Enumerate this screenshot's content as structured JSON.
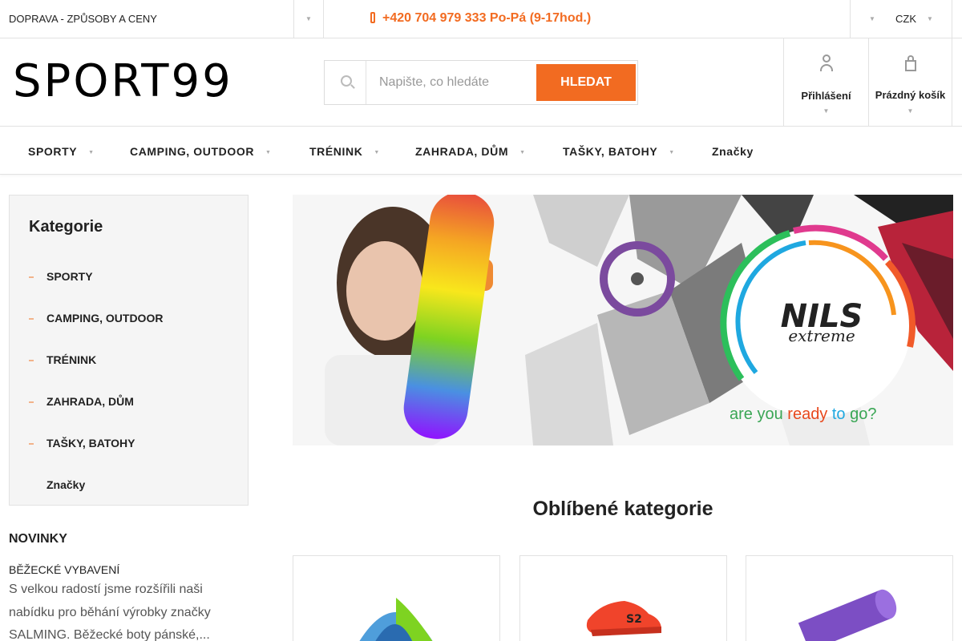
{
  "topbar": {
    "shipping_link": "DOPRAVA - ZPŮSOBY A CENY",
    "phone": "+420 704 979 333 Po-Pá (9-17hod.)",
    "currency": "CZK"
  },
  "header": {
    "logo_text": "SPORT99",
    "search": {
      "placeholder": "Napište, co hledáte",
      "button_label": "HLEDAT"
    },
    "login_label": "Přihlášení",
    "cart_label": "Prázdný košík"
  },
  "nav": {
    "items": [
      {
        "label": "SPORTY"
      },
      {
        "label": "CAMPING, OUTDOOR"
      },
      {
        "label": "TRÉNINK"
      },
      {
        "label": "ZAHRADA, DŮM"
      },
      {
        "label": "TAŠKY, BATOHY"
      },
      {
        "label": "Značky"
      }
    ]
  },
  "sidebar": {
    "title": "Kategorie",
    "items": [
      {
        "label": "SPORTY"
      },
      {
        "label": "CAMPING, OUTDOOR"
      },
      {
        "label": "TRÉNINK"
      },
      {
        "label": "ZAHRADA, DŮM"
      },
      {
        "label": "TAŠKY, BATOHY"
      },
      {
        "label": "Značky"
      }
    ],
    "news_heading": "NOVINKY",
    "news_title": "BĚŽECKÉ VYBAVENÍ",
    "news_text": "S velkou radostí jsme rozšířili naši nabídku pro běhání výrobky značky SALMING. Běžecké boty pánské,..."
  },
  "banner": {
    "brand_top": "NILS",
    "brand_bottom": "extreme",
    "tagline_1": "are you",
    "tagline_2": "ready",
    "tagline_3": "to",
    "tagline_4": "go?"
  },
  "favorites": {
    "title": "Oblíbené kategorie"
  },
  "colors": {
    "accent": "#f26b21",
    "sidebar_bg": "#f5f5f5",
    "border": "#e2e2e2"
  },
  "icons": [
    "phone-icon",
    "search-icon",
    "user-icon",
    "cart-icon",
    "chevron-down-icon"
  ]
}
